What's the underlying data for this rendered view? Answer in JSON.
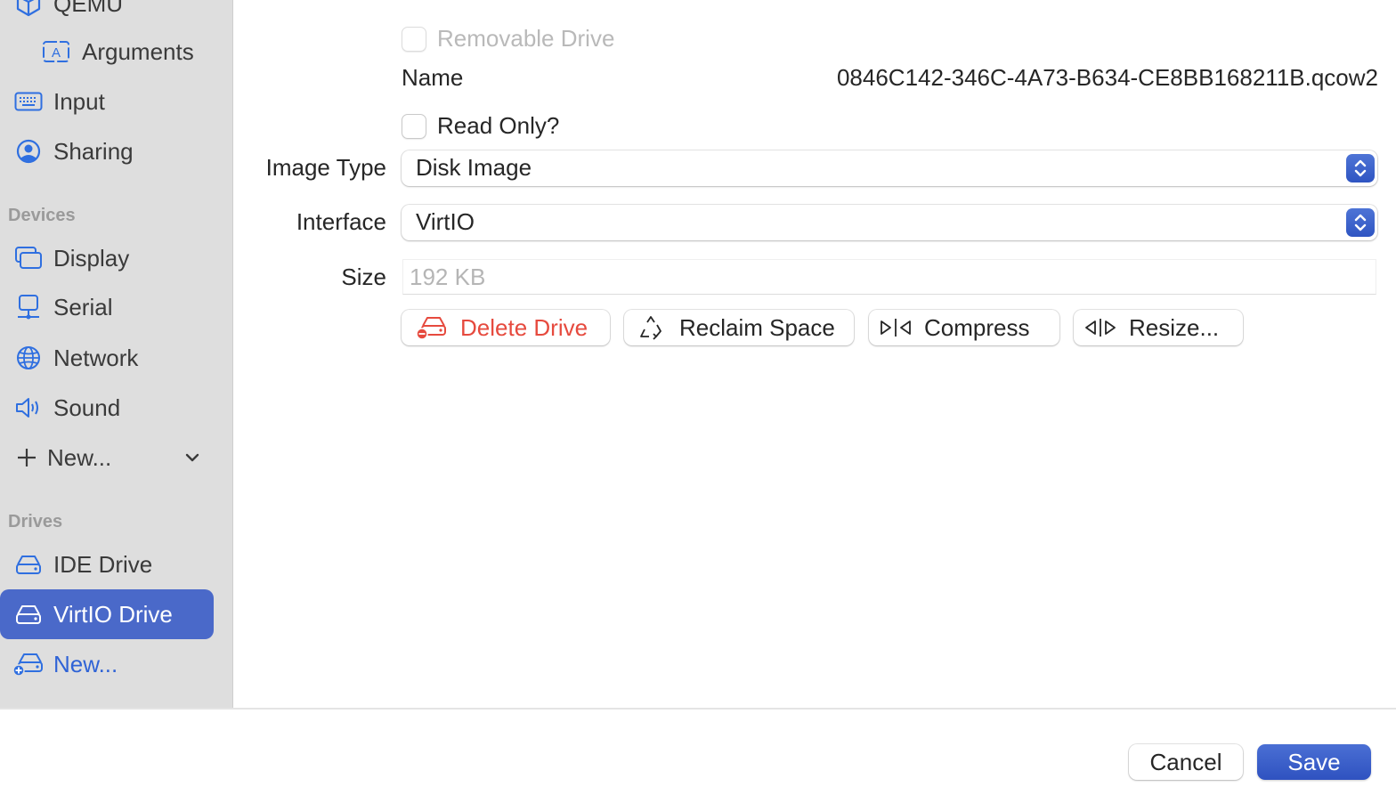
{
  "sidebar": {
    "items_top": [
      {
        "label": "QEMU",
        "icon": "cube-icon"
      },
      {
        "label": "Arguments",
        "icon": "text-a-icon"
      },
      {
        "label": "Input",
        "icon": "keyboard-icon"
      },
      {
        "label": "Sharing",
        "icon": "person-circle-icon"
      }
    ],
    "devices_header": "Devices",
    "devices": [
      {
        "label": "Display",
        "icon": "display-icon"
      },
      {
        "label": "Serial",
        "icon": "serial-icon"
      },
      {
        "label": "Network",
        "icon": "globe-icon"
      },
      {
        "label": "Sound",
        "icon": "speaker-icon"
      }
    ],
    "new_device_label": "New...",
    "drives_header": "Drives",
    "drives": [
      {
        "label": "IDE Drive",
        "icon": "drive-icon",
        "selected": false
      },
      {
        "label": "VirtIO Drive",
        "icon": "drive-icon",
        "selected": true
      }
    ],
    "new_drive_label": "New..."
  },
  "form": {
    "removable_drive": {
      "label": "Removable Drive",
      "checked": false,
      "disabled": true
    },
    "name_label": "Name",
    "name_value": "0846C142-346C-4A73-B634-CE8BB168211B.qcow2",
    "read_only": {
      "label": "Read Only?",
      "checked": false
    },
    "image_type": {
      "label": "Image Type",
      "value": "Disk Image"
    },
    "interface": {
      "label": "Interface",
      "value": "VirtIO"
    },
    "size": {
      "label": "Size",
      "placeholder": "192 KB"
    },
    "buttons": {
      "delete": "Delete Drive",
      "reclaim": "Reclaim Space",
      "compress": "Compress",
      "resize": "Resize..."
    }
  },
  "footer": {
    "cancel": "Cancel",
    "save": "Save"
  },
  "colors": {
    "accent": "#4a69c9",
    "danger": "#e64a3e",
    "icon_blue": "#2f6fe0"
  }
}
